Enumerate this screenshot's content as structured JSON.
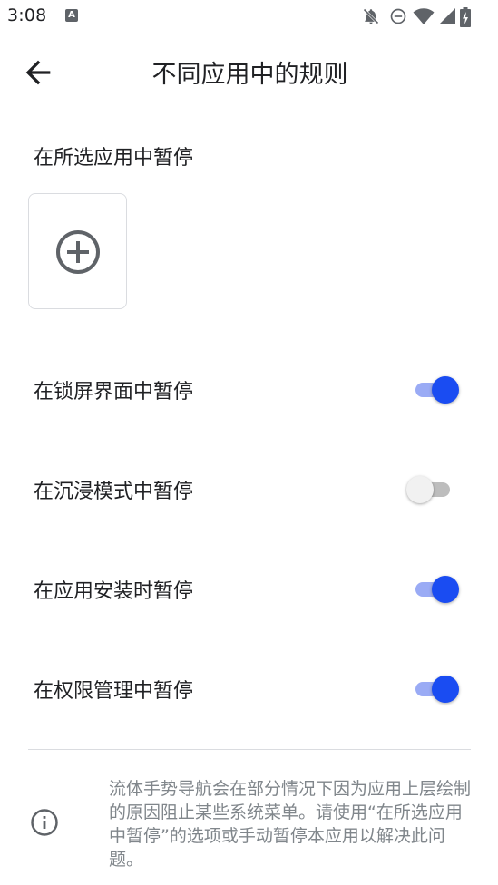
{
  "status_bar": {
    "time": "3:08",
    "notification_icon": "a-letter-badge-icon",
    "icons": [
      "notifications-off-icon",
      "do-not-disturb-icon",
      "wifi-icon",
      "cell-signal-icon",
      "battery-charging-icon"
    ]
  },
  "app_bar": {
    "back_icon": "arrow-back-icon",
    "title": "不同应用中的规则"
  },
  "selected_apps": {
    "label": "在所选应用中暂停",
    "add_icon": "add-circle-icon"
  },
  "settings": [
    {
      "label": "在锁屏界面中暂停",
      "enabled": true
    },
    {
      "label": "在沉浸模式中暂停",
      "enabled": false
    },
    {
      "label": "在应用安装时暂停",
      "enabled": true
    },
    {
      "label": "在权限管理中暂停",
      "enabled": true
    }
  ],
  "info": {
    "icon": "info-icon",
    "text": "流体手势导航会在部分情况下因为应用上层绘制的原因阻止某些系统菜单。请使用“在所选应用中暂停”的选项或手动暂停本应用以解决此问题。"
  },
  "colors": {
    "accent": "#1a4cf2",
    "accent_track": "#9aabf5",
    "off_track": "#bdbdbd",
    "secondary_text": "#80868b"
  }
}
